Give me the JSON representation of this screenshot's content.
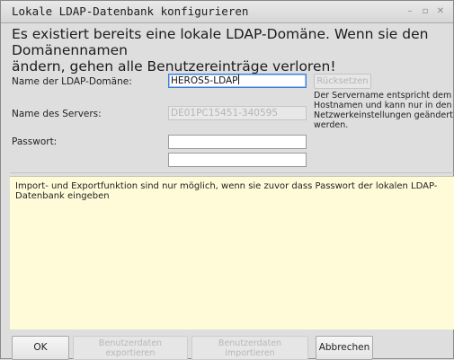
{
  "window": {
    "title": "Lokale LDAP-Datenbank konfigurieren",
    "controls": [
      {
        "name": "minimize-icon",
        "glyph": "–"
      },
      {
        "name": "maximize-icon",
        "glyph": "▫"
      },
      {
        "name": "close-icon",
        "glyph": "✕"
      }
    ]
  },
  "warning": "Es existiert bereits eine lokale LDAP-Domäne. Wenn sie den Domänennamen\nändern, gehen alle Benutzereinträge verloren!",
  "form": {
    "domain_label": "Name der LDAP-Domäne:",
    "domain_value": "HEROS5-LDAP",
    "server_label": "Name des Servers:",
    "server_value": "DE01PC15451-340595",
    "password_label": "Passwort:",
    "password_value": "",
    "password_confirm_value": "",
    "reset_label": "Rücksetzen",
    "hint": "Der Servername entspricht dem\nHostnamen und kann nur in den\nNetzwerkeinstellungen geändert\nwerden."
  },
  "info": "Import- und Exportfunktion sind nur möglich, wenn sie zuvor dass Passwort der lokalen LDAP-Datenbank eingeben",
  "buttons": {
    "ok": "OK",
    "export_line1": "Benutzerdaten",
    "export_line2": "exportieren",
    "import_line1": "Benutzerdaten",
    "import_line2": "importieren",
    "cancel": "Abbrechen"
  },
  "colors": {
    "info_background": "#fffbd8",
    "focus_border": "#3b7ed8"
  }
}
